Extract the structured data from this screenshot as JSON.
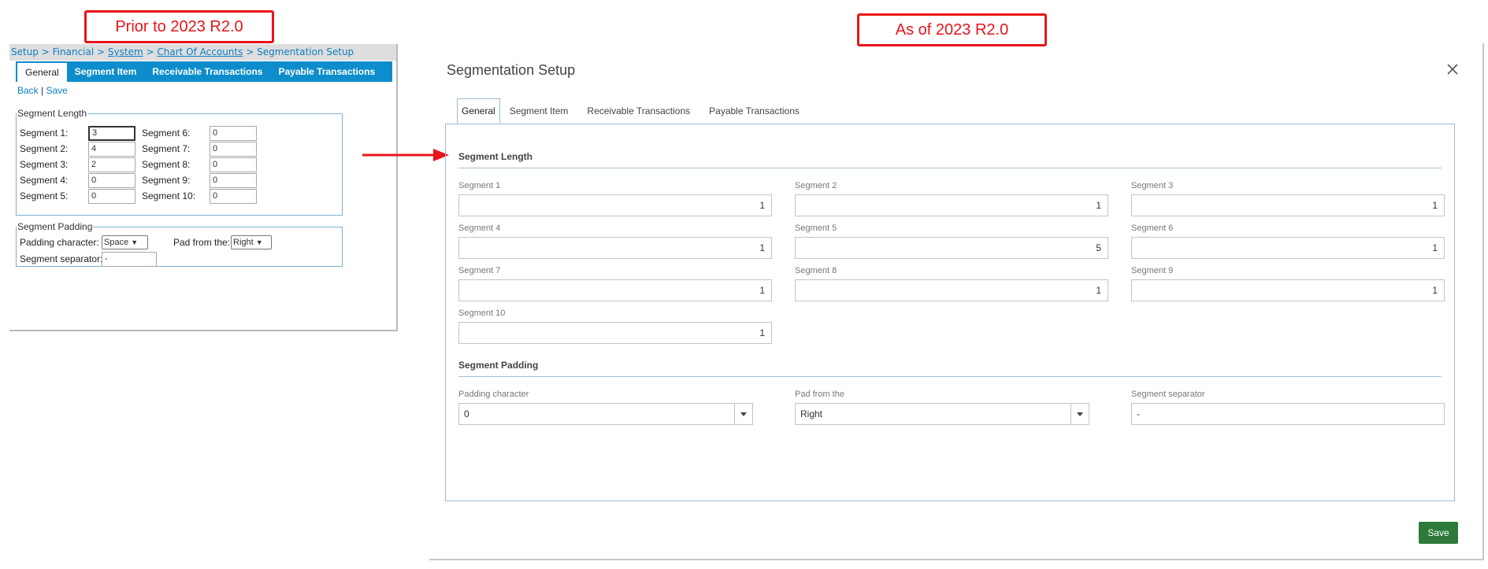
{
  "callouts": {
    "old": "Prior to 2023 R2.0",
    "new": "As of 2023 R2.0"
  },
  "old_ui": {
    "breadcrumb": {
      "setup": "Setup",
      "financial": "Financial",
      "system": "System",
      "chart": "Chart Of Accounts",
      "current": "Segmentation Setup",
      "sep": ">"
    },
    "tabs": [
      "General",
      "Segment Item",
      "Receivable Transactions",
      "Payable Transactions"
    ],
    "links": {
      "back": "Back",
      "sep": "|",
      "save": "Save"
    },
    "segment_length": {
      "legend": "Segment Length",
      "left": [
        {
          "label": "Segment 1:",
          "value": "3"
        },
        {
          "label": "Segment 2:",
          "value": "4"
        },
        {
          "label": "Segment 3:",
          "value": "2"
        },
        {
          "label": "Segment 4:",
          "value": "0"
        },
        {
          "label": "Segment 5:",
          "value": "0"
        }
      ],
      "right": [
        {
          "label": "Segment 6:",
          "value": "0"
        },
        {
          "label": "Segment 7:",
          "value": "0"
        },
        {
          "label": "Segment 8:",
          "value": "0"
        },
        {
          "label": "Segment 9:",
          "value": "0"
        },
        {
          "label": "Segment 10:",
          "value": "0"
        }
      ]
    },
    "segment_padding": {
      "legend": "Segment Padding",
      "padding_char_label": "Padding character:",
      "padding_char_value": "Space",
      "pad_from_label": "Pad from the:",
      "pad_from_value": "Right",
      "separator_label": "Segment separator:",
      "separator_value": "-"
    }
  },
  "new_ui": {
    "title": "Segmentation Setup",
    "tabs": [
      "General",
      "Segment Item",
      "Receivable Transactions",
      "Payable Transactions"
    ],
    "segment_length": {
      "heading": "Segment Length",
      "fields": [
        {
          "label": "Segment 1",
          "value": "1"
        },
        {
          "label": "Segment 2",
          "value": "1"
        },
        {
          "label": "Segment 3",
          "value": "1"
        },
        {
          "label": "Segment 4",
          "value": "1"
        },
        {
          "label": "Segment 5",
          "value": "5"
        },
        {
          "label": "Segment 6",
          "value": "1"
        },
        {
          "label": "Segment 7",
          "value": "1"
        },
        {
          "label": "Segment 8",
          "value": "1"
        },
        {
          "label": "Segment 9",
          "value": "1"
        },
        {
          "label": "Segment 10",
          "value": "1"
        }
      ]
    },
    "segment_padding": {
      "heading": "Segment Padding",
      "padding_char_label": "Padding character",
      "padding_char_value": "0",
      "pad_from_label": "Pad from the",
      "pad_from_value": "Right",
      "separator_label": "Segment separator",
      "separator_value": "-"
    },
    "save_label": "Save"
  },
  "colors": {
    "callout": "#e8141b",
    "old_tab_bar": "#0d8dcc",
    "link": "#0b7ec2",
    "save_button": "#2d7a3b"
  }
}
